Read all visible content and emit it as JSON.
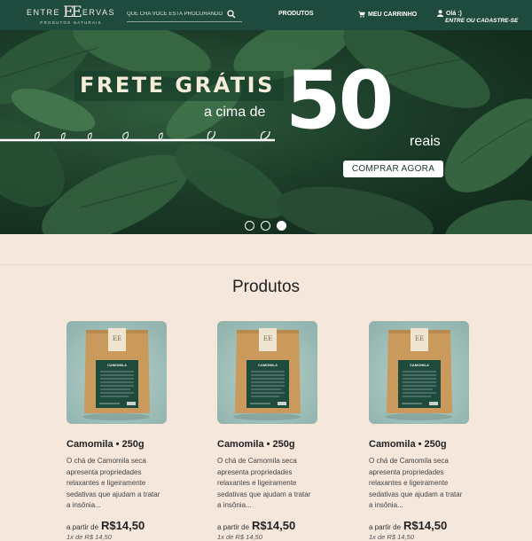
{
  "header": {
    "logo_left": "ENTRE",
    "logo_mark": "EE",
    "logo_right": "ERVAS",
    "logo_subtitle": "PRODUTOS NATURAIS",
    "search_placeholder": "QUE CHA VOCÊ ESTÁ PROCURANDO",
    "nav_products": "PRODUTOS",
    "nav_cart": "MEU CARRINHO",
    "user_greeting": "Olá :)",
    "user_login": "ENTRE OU CADASTRE-SE"
  },
  "banner": {
    "title": "FRETE GRÁTIS",
    "subtitle": "a cima de",
    "amount": "50",
    "unit": "reais",
    "cta_label": "COMPRAR AGORA",
    "slides": 3,
    "active_slide": 3
  },
  "products": {
    "title": "Produtos",
    "package_label": "CAMOMILA",
    "items": [
      {
        "name": "Camomila • 250g",
        "description": "O chá de Camomila seca apresenta propriedades relaxantes e ligeiramente sedativas que ajudam a tratar a insônia...",
        "price_prefix": "a partir de",
        "price": "R$14,50",
        "installment": "1x de R$ 14,50"
      },
      {
        "name": "Camomila • 250g",
        "description": "O chá de Camomila seca apresenta propriedades relaxantes e ligeiramente sedativas que ajudam a tratar a insônia...",
        "price_prefix": "a partir de",
        "price": "R$14,50",
        "installment": "1x de R$ 14,50"
      },
      {
        "name": "Camomila • 250g",
        "description": "O chá de Camomila seca apresenta propriedades relaxantes e ligeiramente sedativas que ajudam a tratar a insônia...",
        "price_prefix": "a partir de",
        "price": "R$14,50",
        "installment": "1x de R$ 14,50"
      }
    ]
  },
  "colors": {
    "header_bg": "#1f4a3e",
    "page_bg": "#f6e7dc",
    "package_kraft": "#c99a5b",
    "package_label": "#1f4a3e"
  },
  "icons": [
    "search-icon",
    "cart-icon",
    "user-icon",
    "branch-icon"
  ]
}
